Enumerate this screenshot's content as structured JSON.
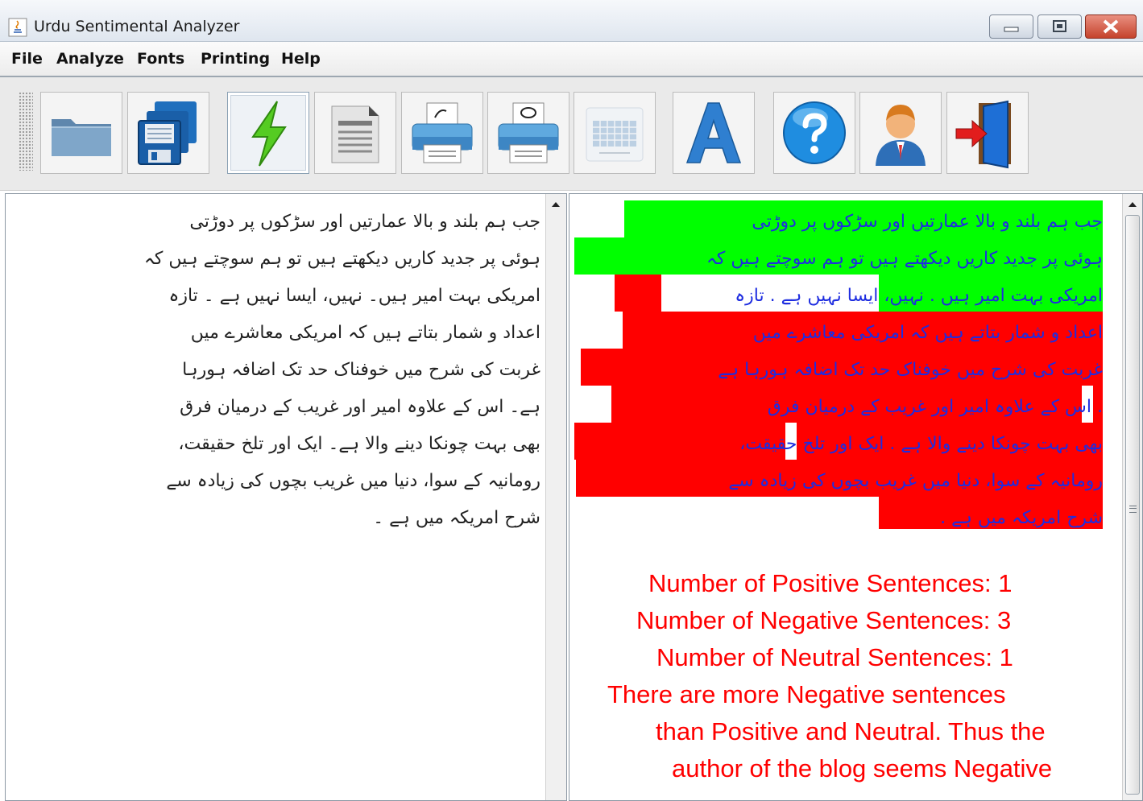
{
  "window": {
    "title": "Urdu Sentimental Analyzer"
  },
  "menu": {
    "items": [
      "File",
      "Analyze",
      "Fonts",
      "Printing",
      "Help"
    ]
  },
  "toolbar": {
    "buttons": [
      {
        "icon": "open-folder-icon"
      },
      {
        "icon": "save-disks-icon"
      },
      {
        "icon": "analyze-lightning-icon",
        "pressed": true
      },
      {
        "icon": "document-icon"
      },
      {
        "icon": "print-icon"
      },
      {
        "icon": "print-preview-icon"
      },
      {
        "icon": "keyboard-icon"
      },
      {
        "icon": "font-a-icon"
      },
      {
        "icon": "help-icon"
      },
      {
        "icon": "user-icon"
      },
      {
        "icon": "exit-door-icon"
      }
    ]
  },
  "input_text": {
    "lines": [
      "جب ہم بلند و بالا عمارتیں اور سڑکوں پر دوڑتی",
      "ہوئی پر جدید کاریں دیکھتے ہیں تو ہم سوچتے ہیں کہ",
      "امریکی بہت امیر ہیں۔ نہیں، ایسا نہیں ہے ۔ تازہ",
      "اعداد و شمار بتاتے ہیں کہ امریکی معاشرے میں",
      "غربت کی شرح میں خوفناک حد تک اضافہ ہورہا",
      "ہے۔ اس کے علاوہ امیر اور غریب کے درمیان فرق",
      "بھی بہت چونکا دینے والا ہے۔ ایک اور تلخ حقیقت،",
      "رومانیہ کے سوا، دنیا میں غریب بچوں کی زیادہ سے",
      "شرح امریکہ میں ہے ۔"
    ]
  },
  "analysis": {
    "lines": [
      "جب ہم بلند و بالا عمارتیں اور سڑکوں پر دوڑتی",
      "ہوئی پر جدید کاریں دیکھتے ہیں تو ہم سوچتے ہیں کہ",
      "امریکی بہت امیر ہیں . نہیں، ایسا نہیں ہے . تازہ",
      "اعداد و شمار بتاتے ہیں کہ امریکی معاشرے میں",
      "غربت کی شرح میں خوفناک حد تک اضافہ ہورہا ہے",
      ". اس کے علاوہ امیر اور غریب کے درمیان فرق",
      "بھی بہت چونکا دینے والا ہے . ایک اور تلخ حقیقت،",
      "رومانیہ کے سوا، دنیا میں غریب بچوں کی زیادہ سے",
      "شرح امریکہ میں ہے ."
    ],
    "highlight_colors": {
      "positive": "#00ff00",
      "negative": "#ff0000",
      "neutral": "#ffffff"
    },
    "text_color": "#1e2de0"
  },
  "results": {
    "positive": "Number of Positive Sentences: 1",
    "negative": "Number of Negative Sentences: 3",
    "neutral": "Number of Neutral Sentences: 1",
    "conclusion_1": "There are more Negative sentences",
    "conclusion_2": "than Positive and Neutral. Thus the",
    "conclusion_3": "author of the blog seems Negative",
    "color": "#ff0000"
  }
}
